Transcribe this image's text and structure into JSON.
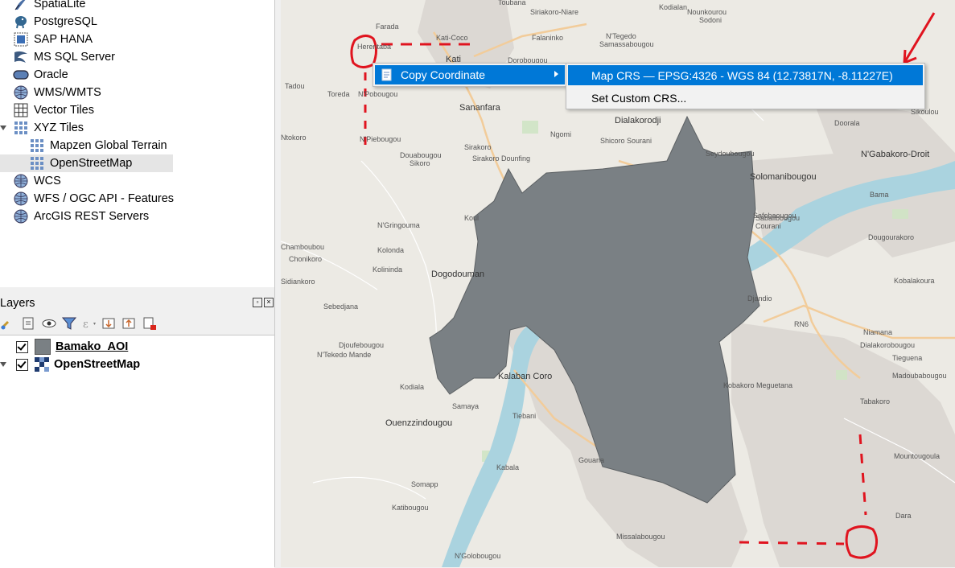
{
  "browser": {
    "items": [
      {
        "label": "SpatiaLite",
        "icon": "spatialite-icon"
      },
      {
        "label": "PostgreSQL",
        "icon": "postgresql-elephant-icon"
      },
      {
        "label": "SAP HANA",
        "icon": "sap-hana-icon"
      },
      {
        "label": "MS SQL Server",
        "icon": "mssql-icon"
      },
      {
        "label": "Oracle",
        "icon": "oracle-icon"
      },
      {
        "label": "WMS/WMTS",
        "icon": "globe-icon"
      },
      {
        "label": "Vector Tiles",
        "icon": "vector-tiles-grid-icon"
      },
      {
        "label": "XYZ Tiles",
        "icon": "xyz-tiles-grid-icon"
      },
      {
        "label": "Mapzen Global Terrain",
        "icon": "xyz-tile-grid-icon"
      },
      {
        "label": "OpenStreetMap",
        "icon": "xyz-tile-grid-icon"
      },
      {
        "label": "WCS",
        "icon": "globe-icon"
      },
      {
        "label": "WFS / OGC API - Features",
        "icon": "globe-icon"
      },
      {
        "label": "ArcGIS REST Servers",
        "icon": "globe-icon"
      }
    ]
  },
  "layers": {
    "title": "Layers",
    "rows": [
      {
        "label": "Bamako_AOI",
        "checked": true
      },
      {
        "label": "OpenStreetMap",
        "checked": true
      }
    ]
  },
  "context_menu": {
    "copy_coordinate": "Copy Coordinate",
    "submenu": {
      "map_crs": "Map CRS — EPSG:4326 - WGS 84 (12.73817N, -8.11227E)",
      "custom_crs": "Set Custom CRS..."
    }
  },
  "map": {
    "labels": [
      "Toubana",
      "Kodialan",
      "Farada",
      "Siriakoro-Niare",
      "Kati-Coco",
      "Falaninko",
      "N'Tegedo",
      "Samassabougou",
      "Nounkourou",
      "Sodoni",
      "Herentaba",
      "Kati",
      "Dorobougou",
      "Tadou",
      "Toreda",
      "N'Pobougou",
      "Sananfara",
      "Ngomi",
      "Dialakorodji",
      "Doorala",
      "Sikoulou",
      "Ntokoro",
      "N'Piebougou",
      "Douabougou",
      "Sikoro",
      "Sirakoro",
      "Sirakoro Dounfing",
      "Shicoro Sourani",
      "Safobaougou",
      "N'Gabakoro-Droit",
      "Seydoubougou",
      "Solomanibougou",
      "Bama",
      "Sabalibougou",
      "Courani",
      "Dougourakoro",
      "N'Gringouma",
      "Chamboubou",
      "Chonikoro",
      "Kolonda",
      "Kolininda",
      "Dogodouman",
      "Sidiankoro",
      "Sebedjana",
      "Djoufebougou",
      "N'Tekedo Mande",
      "Kodiala",
      "Kalaban Coro",
      "Samaya",
      "Ouenzzindougou",
      "Tiebani",
      "Kabala",
      "Gouana",
      "Kobalakoura",
      "Niamana",
      "Dialakorobougou",
      "Tieguena",
      "Madoubabougou",
      "Tabakoro",
      "Somapp",
      "Katibougou",
      "Missalabougou",
      "N'Golobougou",
      "Mountougoula",
      "Dara",
      "Kobakoro Meguetana",
      "Djandio",
      "RN6",
      "Koul"
    ]
  },
  "colors": {
    "selection_blue": "#0078d7",
    "aoi_polygon": "#7a8084",
    "river": "#aad3df",
    "annotation_red": "#e0141f"
  }
}
